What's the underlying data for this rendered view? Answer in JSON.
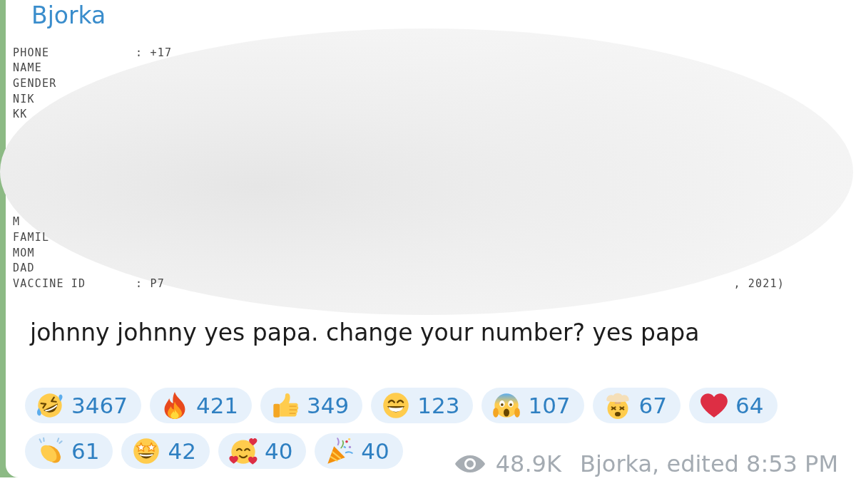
{
  "message": {
    "sender": "Bjorka",
    "data_block": {
      "upper_rows": [
        {
          "label": "PHONE",
          "value": ": +17"
        },
        {
          "label": "NAME"
        },
        {
          "label": "GENDER"
        },
        {
          "label": "NIK"
        },
        {
          "label": "KK"
        }
      ],
      "lower_rows": [
        {
          "label": "M"
        },
        {
          "label": "FAMIL"
        },
        {
          "label": "MOM"
        },
        {
          "label": "DAD"
        },
        {
          "label": "VACCINE ID",
          "value": ": P7",
          "value_end": ", 2021)"
        }
      ]
    },
    "text": "johnny johnny yes papa. change your number? yes papa",
    "reactions": [
      {
        "kind": "rofl",
        "count": "3467"
      },
      {
        "kind": "fire",
        "count": "421"
      },
      {
        "kind": "thumbs-up",
        "count": "349"
      },
      {
        "kind": "grin",
        "count": "123"
      },
      {
        "kind": "scream",
        "count": "107"
      },
      {
        "kind": "exploding-head",
        "count": "67"
      },
      {
        "kind": "heart",
        "count": "64"
      },
      {
        "kind": "clap",
        "count": "61"
      },
      {
        "kind": "star-struck",
        "count": "42"
      },
      {
        "kind": "hearts-face",
        "count": "40"
      },
      {
        "kind": "party",
        "count": "40"
      }
    ],
    "views": "48.9K",
    "signature": "Bjorka, edited 8:53 PM"
  }
}
